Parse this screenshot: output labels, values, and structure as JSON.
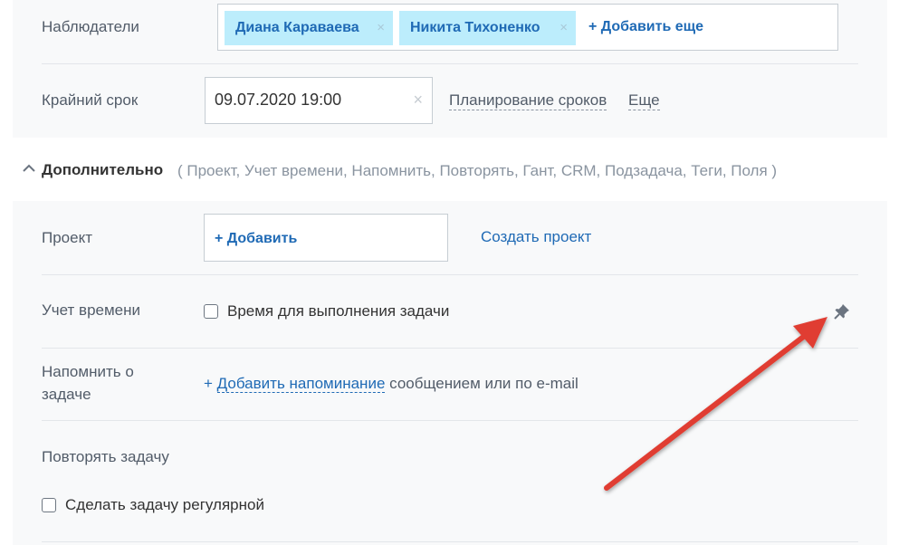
{
  "observers": {
    "label": "Наблюдатели",
    "tags": [
      {
        "name": "Диана Караваева",
        "remove": "×"
      },
      {
        "name": "Никита Тихоненко",
        "remove": "×"
      }
    ],
    "add_more": "+ Добавить еще"
  },
  "deadline": {
    "label": "Крайний срок",
    "value": "09.07.2020 19:00",
    "clear": "×",
    "planning_link": "Планирование сроков",
    "more_link": "Еще"
  },
  "additional": {
    "title": "Дополнительно",
    "list": "( Проект,  Учет времени,  Напомнить,  Повторять,  Гант,  CRM,  Подзадача,  Теги,  Поля )"
  },
  "project": {
    "label": "Проект",
    "add": "+ Добавить",
    "create_link": "Создать проект"
  },
  "time_tracking": {
    "label": "Учет времени",
    "checkbox_label": "Время для выполнения задачи",
    "checked": false
  },
  "reminder": {
    "label_line1": "Напомнить о",
    "label_line2": "задаче",
    "plus": "+",
    "add_link": "Добавить напоминание",
    "suffix": "сообщением или по e-mail"
  },
  "repeat": {
    "label": "Повторять задачу",
    "checkbox_label": "Сделать задачу регулярной",
    "checked": false
  },
  "colors": {
    "link": "#1f6ab5",
    "tag_bg": "#bcedfc",
    "annotation_arrow": "#e03c31"
  },
  "icons": [
    "chevron-up-icon",
    "pin-icon",
    "close-icon"
  ]
}
